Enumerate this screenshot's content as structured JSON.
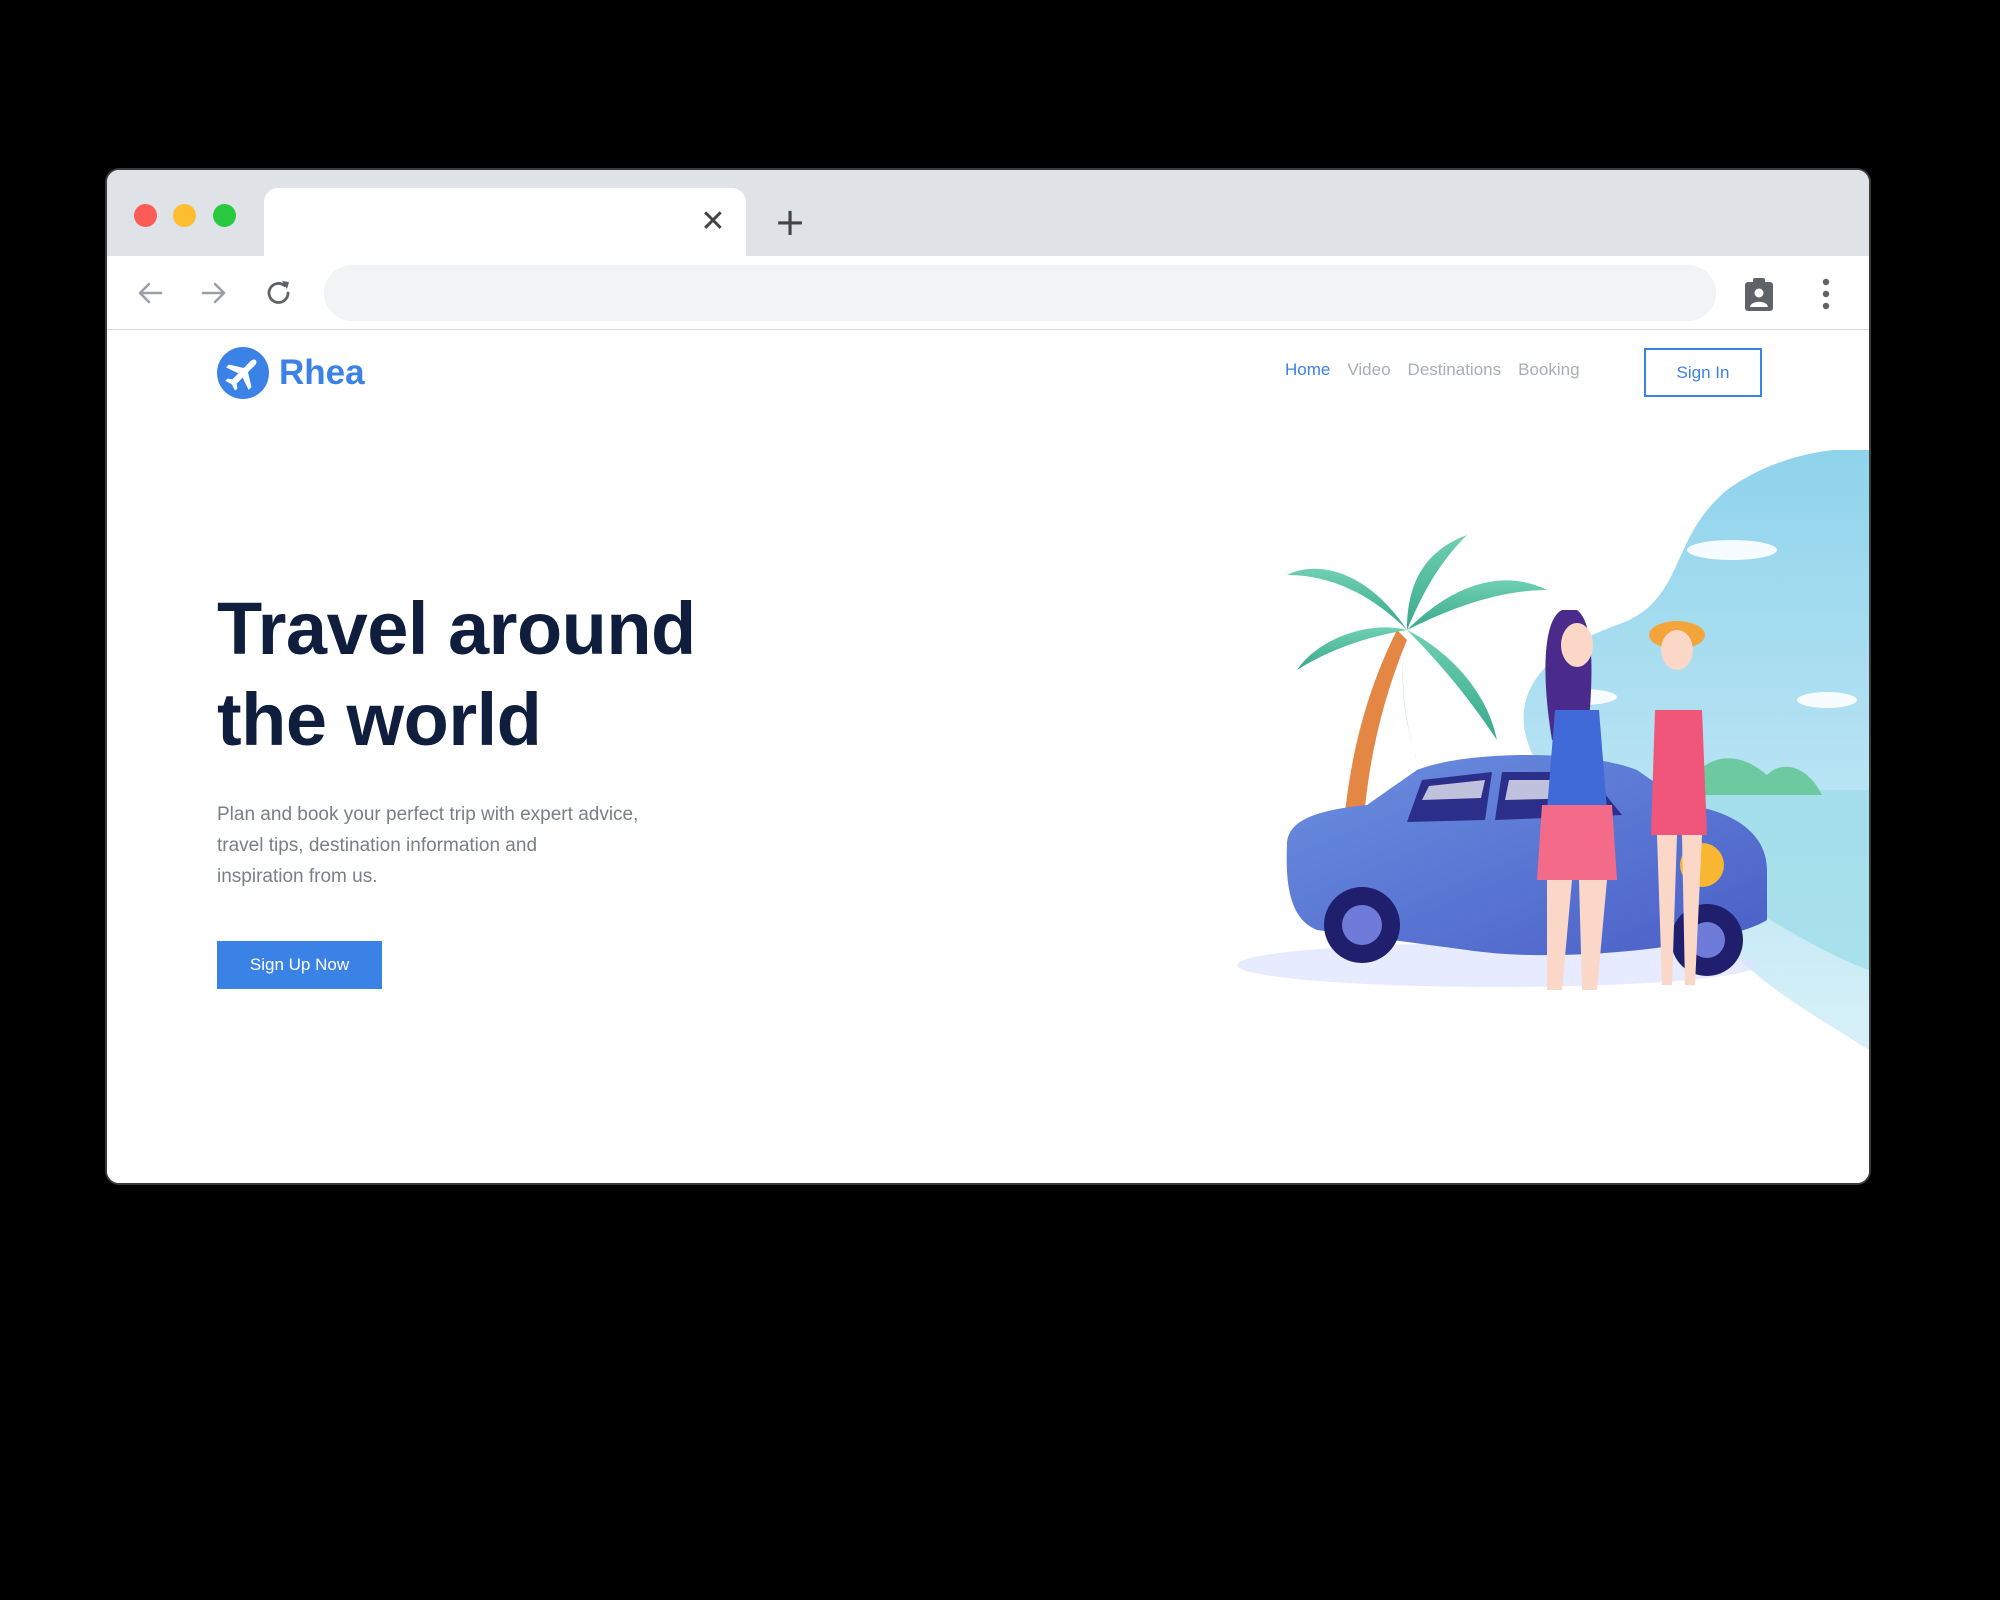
{
  "browser": {
    "tab": {
      "title": "",
      "close_glyph": "✕"
    },
    "new_tab_glyph": "+",
    "address_bar": {
      "value": ""
    },
    "icons": {
      "back": "arrow-left-icon",
      "forward": "arrow-right-icon",
      "reload": "reload-icon",
      "extension": "clipboard-user-icon",
      "menu": "vertical-dots-icon"
    }
  },
  "site": {
    "brand": {
      "name": "Rhea",
      "logo_icon": "airplane-icon"
    },
    "nav": [
      {
        "label": "Home",
        "active": true
      },
      {
        "label": "Video",
        "active": false
      },
      {
        "label": "Destinations",
        "active": false
      },
      {
        "label": "Booking",
        "active": false
      }
    ],
    "signin_label": "Sign In",
    "hero": {
      "title_line1": "Travel around",
      "title_line2": "the world",
      "subtitle_line1": "Plan and book your perfect trip with expert advice,",
      "subtitle_line2": "travel tips, destination information and",
      "subtitle_line3": "inspiration from us.",
      "cta_label": "Sign Up Now"
    }
  },
  "colors": {
    "accent": "#3b82e6",
    "heading": "#0f1e3d",
    "body_text": "#7a7e86",
    "nav_inactive": "#a9adb5"
  }
}
